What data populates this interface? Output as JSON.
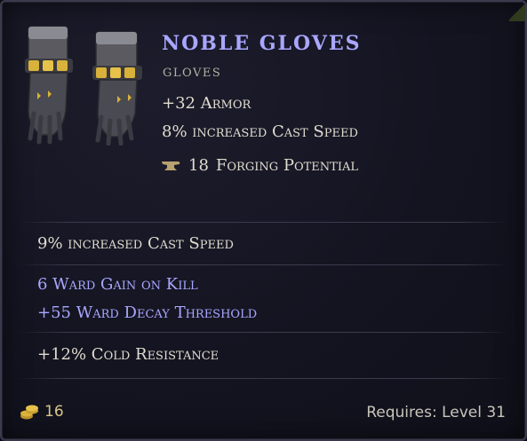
{
  "item": {
    "name": "Noble Gloves",
    "type": "Gloves",
    "implicits": [
      {
        "value": "+32",
        "label": "Armor"
      },
      {
        "value": "8%",
        "label": "increased Cast Speed"
      }
    ],
    "forging_potential": {
      "value": "18",
      "label": "Forging Potential",
      "icon": "anvil-icon"
    },
    "image_icon": "gloves-icon"
  },
  "affixes": [
    "9% increased Cast Speed",
    "6 Ward Gain on Kill",
    "+55 Ward Decay Threshold",
    "+12% Cold Resistance"
  ],
  "footer": {
    "gold_value": "16",
    "gold_icon": "gold-coins-icon",
    "requirement": "Requires: Level 31"
  },
  "colors": {
    "affix_magic": "#a9a7ff",
    "text": "#e0dccf",
    "gold": "#d6c68a"
  }
}
